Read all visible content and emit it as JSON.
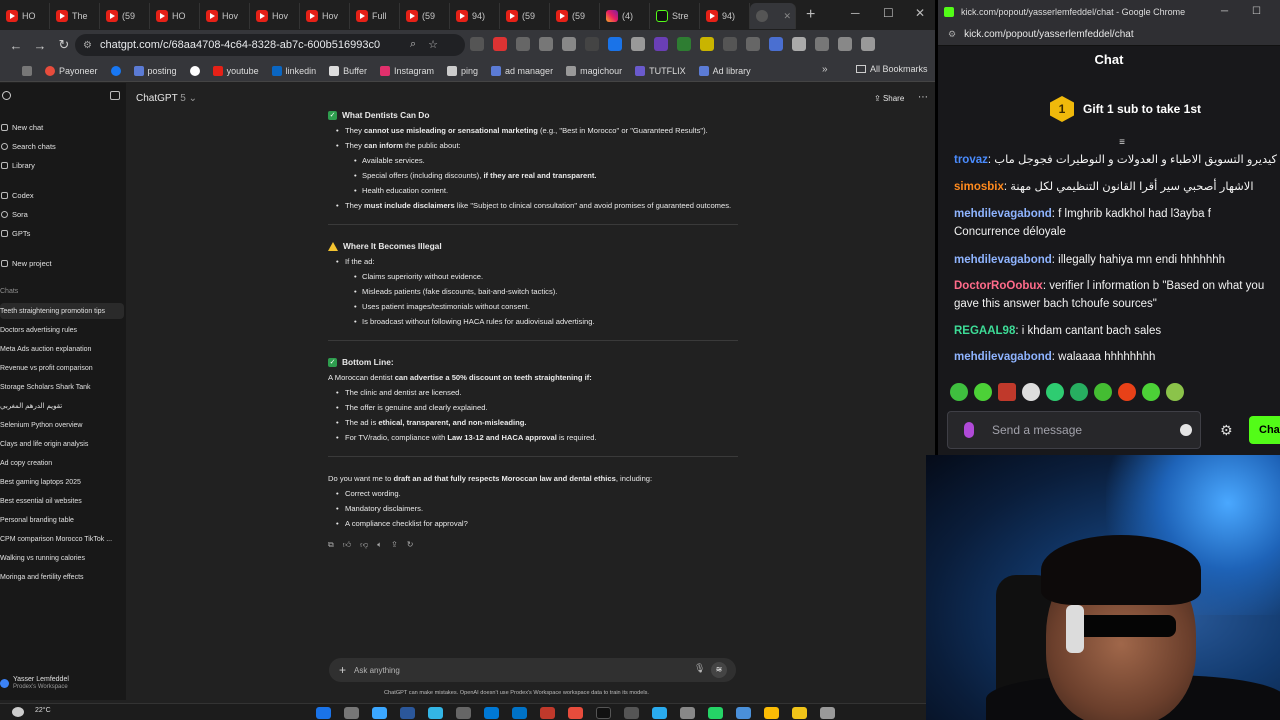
{
  "browser": {
    "tabs": [
      {
        "label": "HO",
        "icon": "youtube-icon"
      },
      {
        "label": "The",
        "icon": "youtube-icon"
      },
      {
        "label": "(59",
        "icon": "youtube-icon"
      },
      {
        "label": "HO",
        "icon": "youtube-icon"
      },
      {
        "label": "Hov",
        "icon": "youtube-icon"
      },
      {
        "label": "Hov",
        "icon": "youtube-icon"
      },
      {
        "label": "Hov",
        "icon": "youtube-icon"
      },
      {
        "label": "Full",
        "icon": "youtube-icon"
      },
      {
        "label": "(59",
        "icon": "youtube-icon"
      },
      {
        "label": "94)",
        "icon": "youtube-icon"
      },
      {
        "label": "(59",
        "icon": "youtube-icon"
      },
      {
        "label": "(59",
        "icon": "youtube-icon"
      },
      {
        "label": "(4)",
        "icon": "instagram-icon"
      },
      {
        "label": "Stre",
        "icon": "kick-icon"
      },
      {
        "label": "94)",
        "icon": "youtube-icon"
      }
    ],
    "url": "chatgpt.com/c/68aa4708-4c64-8328-ab7c-600b516993c0",
    "bookmarks": [
      "Payoneer",
      "posting",
      "youtube",
      "linkedin",
      "Buffer",
      "Instagram",
      "ping",
      "ad manager",
      "magichour",
      "TUTFLIX",
      "Ad library"
    ],
    "all_bookmarks": "All Bookmarks"
  },
  "sidebar": {
    "nav": [
      "New chat",
      "Search chats",
      "Library",
      "Codex",
      "Sora",
      "GPTs",
      "New project"
    ],
    "chats_label": "Chats",
    "chats": [
      "Teeth straightening promotion tips",
      "Doctors advertising rules",
      "Meta Ads auction explanation",
      "Revenue vs profit comparison",
      "Storage Scholars Shark Tank",
      "تقويم الدرهم المغربي",
      "Selenium Python overview",
      "Clays and life origin analysis",
      "Ad copy creation",
      "Best gaming laptops 2025",
      "Best essential oil websites",
      "Personal branding table",
      "CPM comparison Morocco TikTok ...",
      "Walking vs running calories",
      "Moringa and fertility effects"
    ],
    "user_name": "Yasser Lemfeddel",
    "workspace": "Prodex's Workspace"
  },
  "header": {
    "model": "ChatGPT",
    "version": "5",
    "share": "Share"
  },
  "content": {
    "s1_title": "What Dentists Can Do",
    "s1_b1_pre": "They ",
    "s1_b1_bold": "cannot use misleading or sensational marketing",
    "s1_b1_post": " (e.g., \"Best in Morocco\" or \"Guaranteed Results\").",
    "s1_b2_pre": "They ",
    "s1_b2_bold": "can inform",
    "s1_b2_post": " the public about:",
    "s1_sub1": "Available services.",
    "s1_sub2_pre": "Special offers (including discounts), ",
    "s1_sub2_bold": "if they are real and transparent.",
    "s1_sub3": "Health education content.",
    "s1_b3_pre": "They ",
    "s1_b3_bold": "must include disclaimers",
    "s1_b3_post": " like \"Subject to clinical consultation\" and avoid promises of guaranteed outcomes.",
    "s2_title": "Where It Becomes Illegal",
    "s2_b1": "If the ad:",
    "s2_sub1": "Claims superiority without evidence.",
    "s2_sub2": "Misleads patients (fake discounts, bait-and-switch tactics).",
    "s2_sub3": "Uses patient images/testimonials without consent.",
    "s2_sub4": "Is broadcast without following HACA rules for audiovisual advertising.",
    "s3_title": "Bottom Line:",
    "s3_intro_pre": "A Moroccan dentist ",
    "s3_intro_bold": "can advertise a 50% discount on teeth straightening if:",
    "s3_b1": "The clinic and dentist are licensed.",
    "s3_b2": "The offer is genuine and clearly explained.",
    "s3_b3_pre": "The ad is ",
    "s3_b3_bold": "ethical, transparent, and non-misleading.",
    "s3_b4_pre": "For TV/radio, compliance with ",
    "s3_b4_bold": "Law 13-12 and HACA approval",
    "s3_b4_post": " is required.",
    "q_pre": "Do you want me to ",
    "q_bold": "draft an ad that fully respects Moroccan law and dental ethics",
    "q_post": ", including:",
    "q_b1": "Correct wording.",
    "q_b2": "Mandatory disclaimers.",
    "q_b3": "A compliance checklist for approval?"
  },
  "composer": {
    "placeholder": "Ask anything",
    "disclaimer": "ChatGPT can make mistakes. OpenAI doesn't use Prodex's Workspace workspace data to train its models."
  },
  "taskbar": {
    "temperature": "22°C"
  },
  "kick": {
    "window_title": "kick.com/popout/yasserlemfeddel/chat - Google Chrome",
    "url": "kick.com/popout/yasserlemfeddel/chat",
    "heading": "Chat",
    "gift_rank": "1",
    "gift_text": "Gift 1 sub to take 1st",
    "messages": [
      {
        "user": "trovaz",
        "color": "#4a8cff",
        "text": "كيديرو التسويق الاطباء و العدولات و النوطيرات فجوجل ماب"
      },
      {
        "user": "simosbix",
        "color": "#ff8a1e",
        "text": "الاشهار أصحبي سير أقرا القانون التنظيمي لكل مهنة"
      },
      {
        "user": "mehdilevagabond",
        "color": "#8fb4ff",
        "text": "f lmghrib kadkhol had l3ayba f"
      },
      {
        "user": "",
        "color": "#8fb4ff",
        "text": "Concurrence déloyale"
      },
      {
        "user": "mehdilevagabond",
        "color": "#8fb4ff",
        "text": "illegally hahiya mn endi hhhhhhh"
      },
      {
        "user": "DoctorRoOobux",
        "color": "#ff6b8a",
        "text": "verifier l information b \"Based on what you"
      },
      {
        "user": "",
        "color": "#ff6b8a",
        "text": "gave this answer bach tchoufe sources\""
      },
      {
        "user": "REGAAL98",
        "color": "#3ddc97",
        "text": "i khdam cantant bach sales"
      },
      {
        "user": "mehdilevagabond",
        "color": "#8fb4ff",
        "text": "walaaaa hhhhhhhh"
      }
    ],
    "input_placeholder": "Send a message",
    "send_label": "Chat"
  }
}
